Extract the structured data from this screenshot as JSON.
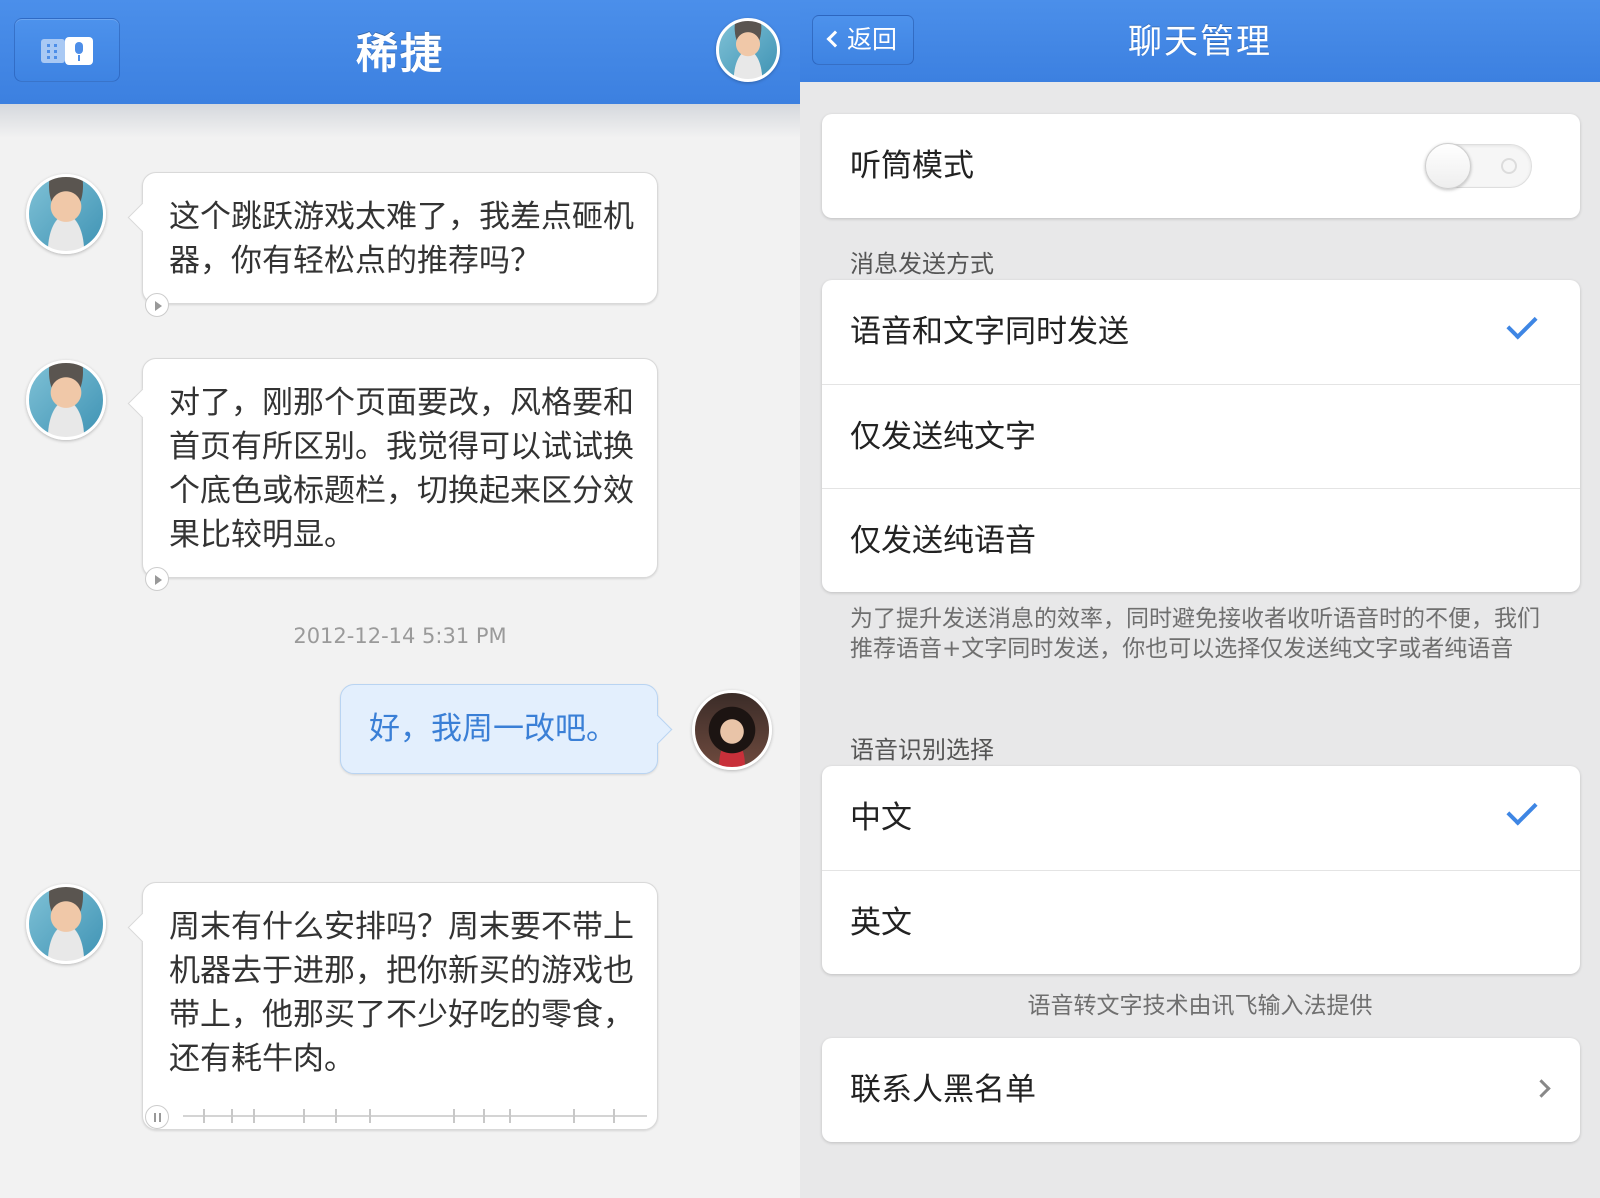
{
  "chat": {
    "title": "稀捷",
    "messages": [
      {
        "text": "这个跳跃游戏太难了，我差点砸机器，你有轻松点的推荐吗？"
      },
      {
        "text": "对了，刚那个页面要改，风格要和首页有所区别。我觉得可以试试换个底色或标题栏，切换起来区分效果比较明显。"
      },
      {
        "text": "好，我周一改吧。"
      },
      {
        "text": "周末有什么安排吗？周末要不带上机器去于进那，把你新买的游戏也带上，他那买了不少好吃的零食，还有耗牛肉。"
      }
    ],
    "timestamp": "2012-12-14 5:31 PM"
  },
  "settings": {
    "back_label": "返回",
    "title": "聊天管理",
    "earpiece": {
      "label": "听筒模式",
      "on": false
    },
    "send_mode": {
      "header": "消息发送方式",
      "options": [
        {
          "label": "语音和文字同时发送",
          "checked": true
        },
        {
          "label": "仅发送纯文字",
          "checked": false
        },
        {
          "label": "仅发送纯语音",
          "checked": false
        }
      ],
      "note": "为了提升发送消息的效率，同时避免接收者收听语音时的不便，我们推荐语音+文字同时发送，你也可以选择仅发送纯文字或者纯语音"
    },
    "recognition": {
      "header": "语音识别选择",
      "options": [
        {
          "label": "中文",
          "checked": true
        },
        {
          "label": "英文",
          "checked": false
        }
      ],
      "note": "语音转文字技术由讯飞输入法提供"
    },
    "blacklist_label": "联系人黑名单"
  },
  "colors": {
    "accent": "#4289e6",
    "check": "#3e86e4",
    "background": "#f2f2f2"
  }
}
